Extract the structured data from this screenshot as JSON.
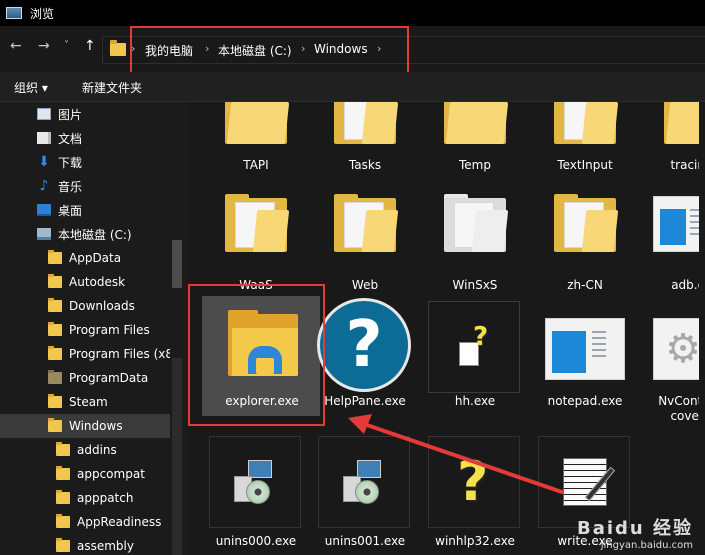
{
  "window": {
    "title": "浏览"
  },
  "nav": {
    "back": "←",
    "forward": "→",
    "recent": "˅",
    "up": "↑"
  },
  "breadcrumb": [
    {
      "label": "我的电脑"
    },
    {
      "label": "本地磁盘 (C:)"
    },
    {
      "label": "Windows"
    }
  ],
  "breadcrumb_separator": "›",
  "toolbar": {
    "organize": "组织 ▾",
    "new_folder": "新建文件夹"
  },
  "sidebar": {
    "items": [
      {
        "label": "图片",
        "icon": "pictures-icon"
      },
      {
        "label": "文档",
        "icon": "documents-icon"
      },
      {
        "label": "下载",
        "icon": "download-icon"
      },
      {
        "label": "音乐",
        "icon": "music-icon"
      },
      {
        "label": "桌面",
        "icon": "desktop-icon"
      },
      {
        "label": "本地磁盘 (C:)",
        "icon": "drive-icon"
      },
      {
        "label": "AppData",
        "icon": "folder-icon"
      },
      {
        "label": "Autodesk",
        "icon": "folder-icon"
      },
      {
        "label": "Downloads",
        "icon": "folder-icon"
      },
      {
        "label": "Program Files",
        "icon": "folder-icon"
      },
      {
        "label": "Program Files (x8",
        "icon": "folder-icon"
      },
      {
        "label": "ProgramData",
        "icon": "folder-icon"
      },
      {
        "label": "Steam",
        "icon": "folder-icon"
      },
      {
        "label": "Windows",
        "icon": "folder-icon",
        "selected": true
      },
      {
        "label": "addins",
        "icon": "folder-icon"
      },
      {
        "label": "appcompat",
        "icon": "folder-icon"
      },
      {
        "label": "apppatch",
        "icon": "folder-icon"
      },
      {
        "label": "AppReadiness",
        "icon": "folder-icon"
      },
      {
        "label": "assembly",
        "icon": "folder-icon"
      }
    ]
  },
  "files": {
    "row1": [
      "TAPI",
      "Tasks",
      "Temp",
      "TextInput",
      "tracin"
    ],
    "row2": [
      "WaaS",
      "Web",
      "WinSxS",
      "zh-CN",
      "adb.e"
    ],
    "row3": [
      "explorer.exe",
      "HelpPane.exe",
      "hh.exe",
      "notepad.exe",
      "NvContai",
      "covery."
    ],
    "row4": [
      "unins000.exe",
      "unins001.exe",
      "winhlp32.exe",
      "write.exe"
    ]
  },
  "watermark": {
    "brand": "Baidu 经验",
    "url": "jingyan.baidu.com"
  },
  "colors": {
    "annotation": "#e33a3a",
    "accent": "#2f8ee8",
    "folder": "#f0c850"
  }
}
